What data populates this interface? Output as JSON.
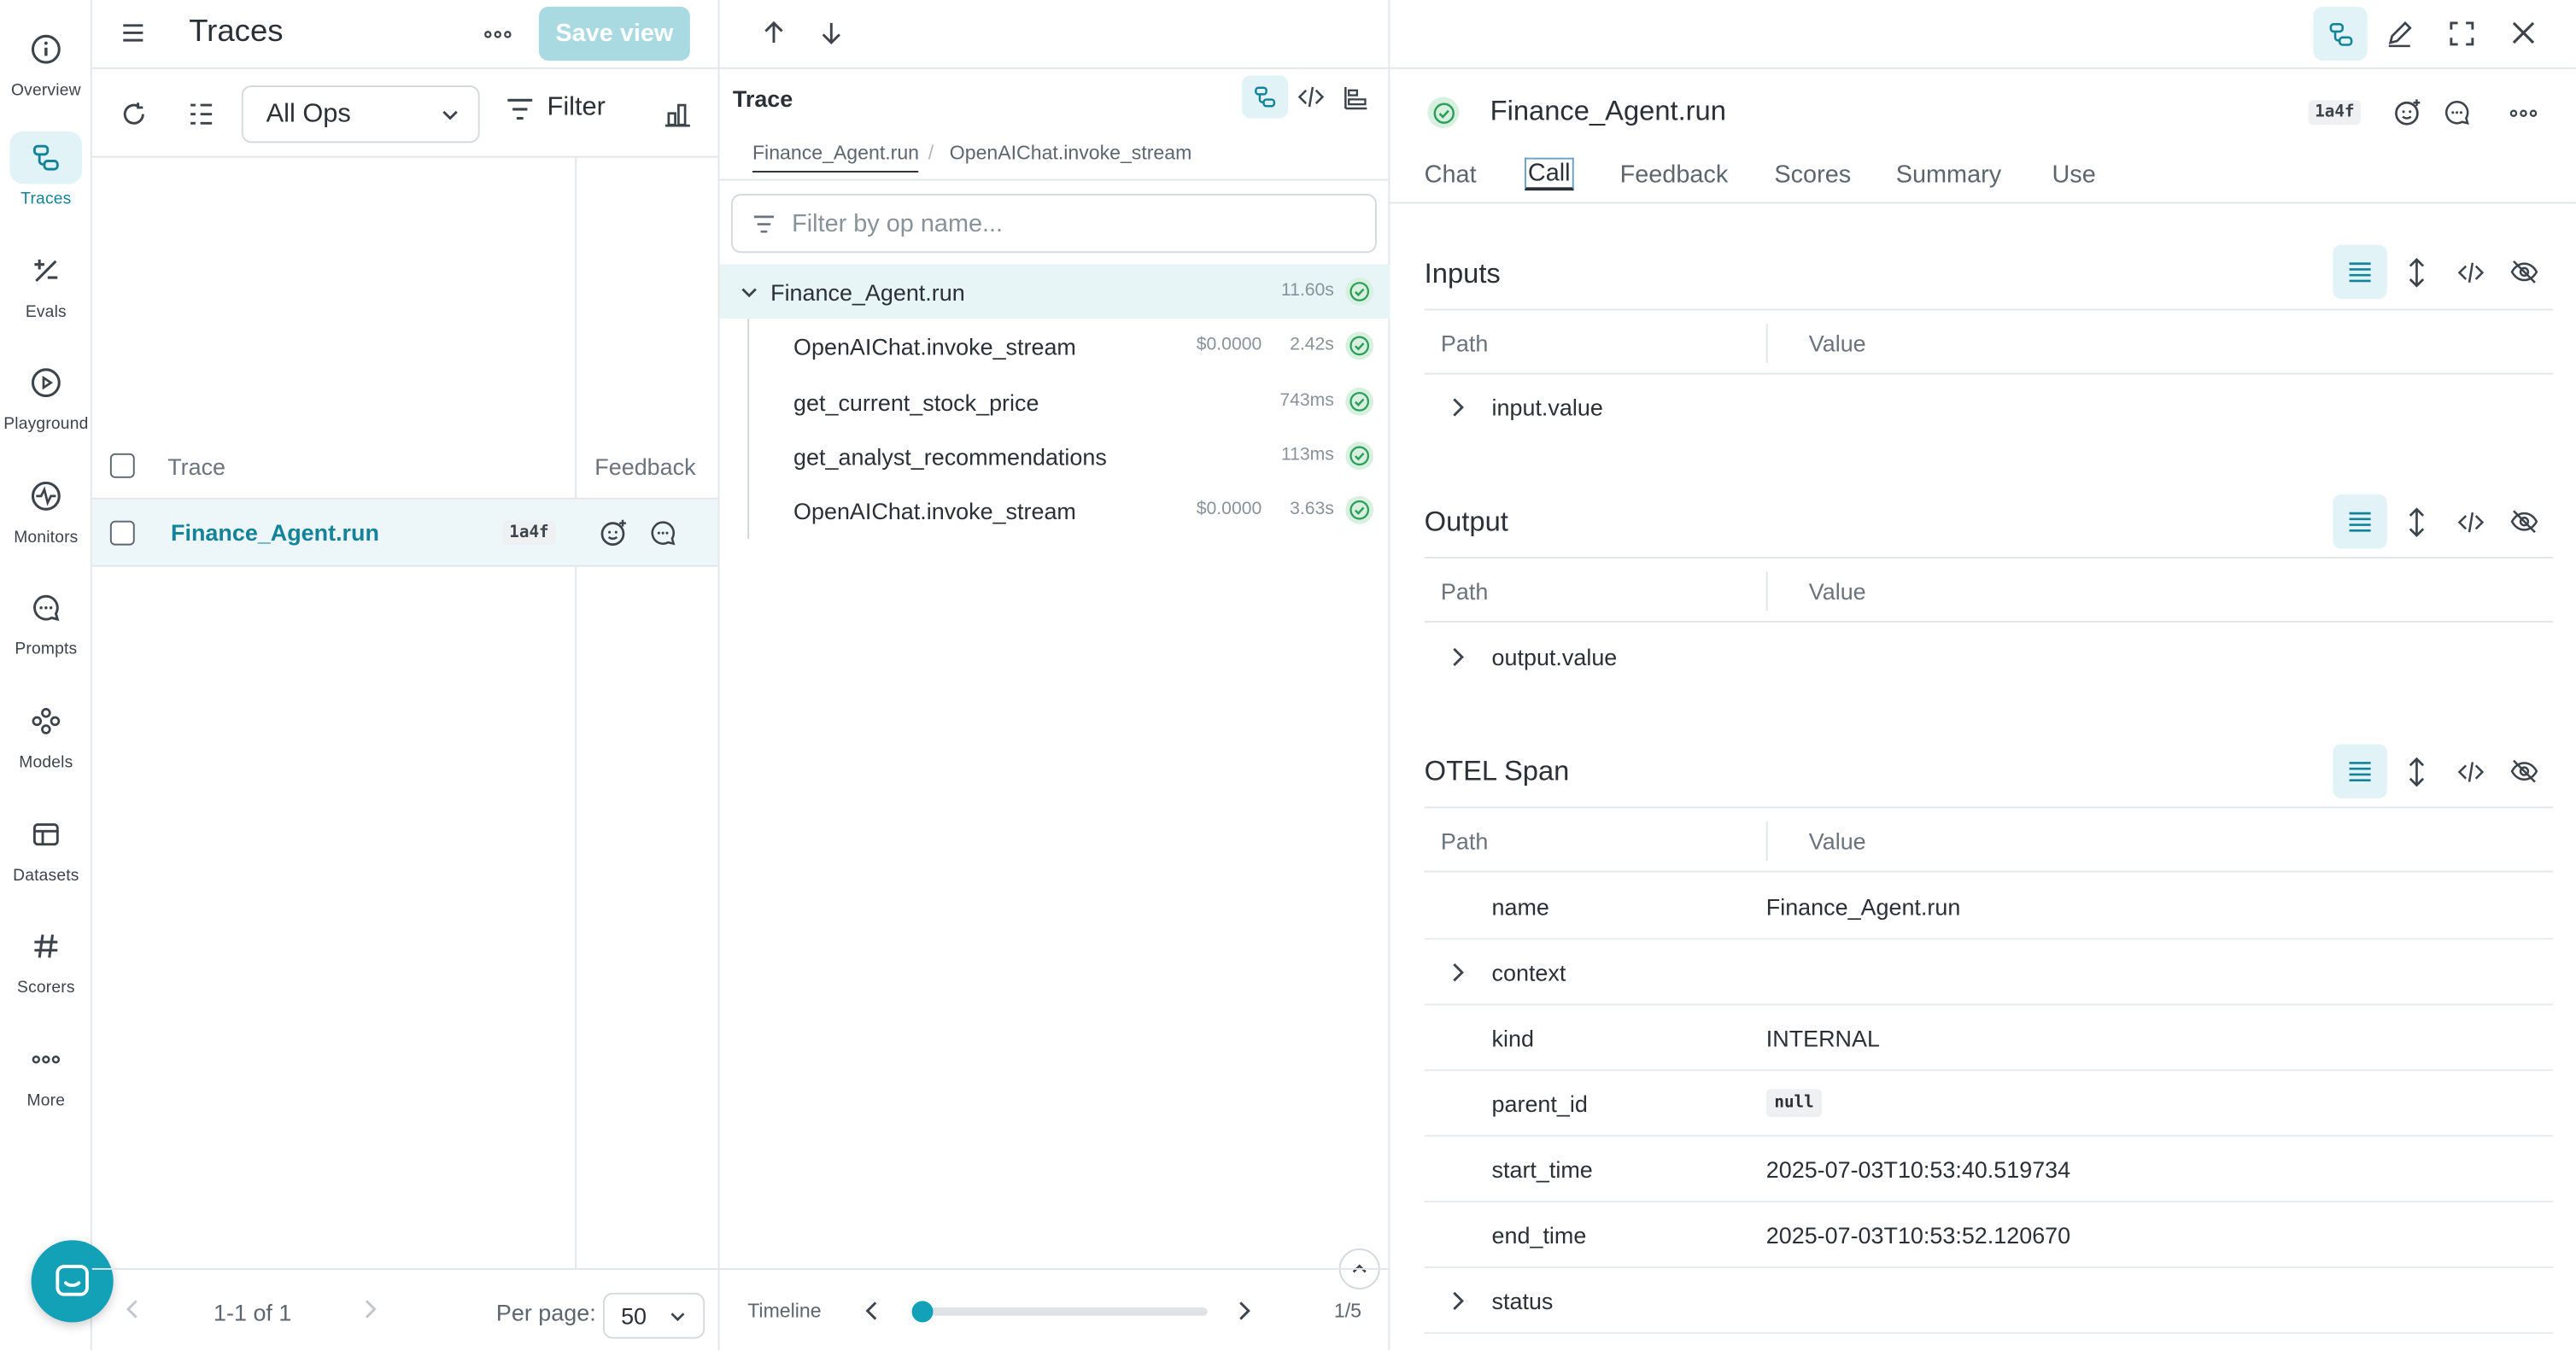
{
  "nav": {
    "items": [
      {
        "label": "Overview",
        "icon": "info-circle-icon"
      },
      {
        "label": "Traces",
        "icon": "traces-icon",
        "active": true
      },
      {
        "label": "Evals",
        "icon": "evals-icon"
      },
      {
        "label": "Playground",
        "icon": "play-circle-icon"
      },
      {
        "label": "Monitors",
        "icon": "monitor-icon"
      },
      {
        "label": "Prompts",
        "icon": "chat-bubble-icon"
      },
      {
        "label": "Models",
        "icon": "models-icon"
      },
      {
        "label": "Datasets",
        "icon": "datasets-icon"
      },
      {
        "label": "Scorers",
        "icon": "hash-icon"
      },
      {
        "label": "More",
        "icon": "more-dots-icon"
      }
    ]
  },
  "traces_panel": {
    "title": "Traces",
    "save_view_label": "Save view",
    "ops_select_value": "All Ops",
    "filter_label": "Filter",
    "columns": {
      "trace": "Trace",
      "feedback": "Feedback"
    },
    "rows": [
      {
        "name": "Finance_Agent.run",
        "badge": "1a4f"
      }
    ],
    "pager": {
      "range": "1-1 of 1",
      "per_page_label": "Per page:",
      "per_page_value": "50"
    }
  },
  "tree_panel": {
    "title": "Trace",
    "breadcrumbs": [
      "Finance_Agent.run",
      "/",
      "OpenAIChat.invoke_stream"
    ],
    "filter_placeholder": "Filter by op name...",
    "nodes": [
      {
        "name": "Finance_Agent.run",
        "cost": "",
        "duration": "11.60s"
      },
      {
        "name": "OpenAIChat.invoke_stream",
        "cost": "$0.0000",
        "duration": "2.42s"
      },
      {
        "name": "get_current_stock_price",
        "cost": "",
        "duration": "743ms"
      },
      {
        "name": "get_analyst_recommendations",
        "cost": "",
        "duration": "113ms"
      },
      {
        "name": "OpenAIChat.invoke_stream",
        "cost": "$0.0000",
        "duration": "3.63s"
      }
    ],
    "timeline": {
      "label": "Timeline",
      "position": "1/5"
    }
  },
  "detail": {
    "title": "Finance_Agent.run",
    "badge": "1a4f",
    "tabs": [
      "Chat",
      "Call",
      "Feedback",
      "Scores",
      "Summary",
      "Use"
    ],
    "active_tab": "Call",
    "sections": {
      "inputs": {
        "title": "Inputs",
        "path_col": "Path",
        "value_col": "Value",
        "rows": [
          {
            "key": "input.value",
            "value": ""
          }
        ]
      },
      "output": {
        "title": "Output",
        "path_col": "Path",
        "value_col": "Value",
        "rows": [
          {
            "key": "output.value",
            "value": ""
          }
        ]
      },
      "otel": {
        "title": "OTEL Span",
        "path_col": "Path",
        "value_col": "Value",
        "rows": [
          {
            "key": "name",
            "value": "Finance_Agent.run"
          },
          {
            "key": "context",
            "value": ""
          },
          {
            "key": "kind",
            "value": "INTERNAL"
          },
          {
            "key": "parent_id",
            "value": "null"
          },
          {
            "key": "start_time",
            "value": "2025-07-03T10:53:40.519734"
          },
          {
            "key": "end_time",
            "value": "2025-07-03T10:53:52.120670"
          },
          {
            "key": "status",
            "value": ""
          }
        ]
      }
    }
  },
  "colors": {
    "accent": "#13839a",
    "accent_bg": "#e1f3f6",
    "success_bg": "#d7f0e0",
    "success": "#2e9e5b"
  }
}
